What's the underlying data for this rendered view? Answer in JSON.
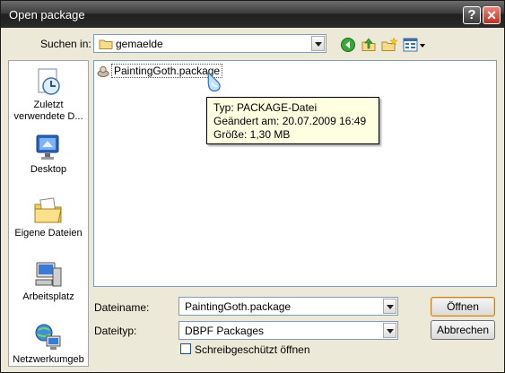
{
  "window": {
    "title": "Open package",
    "help_glyph": "?",
    "close_glyph": "✕"
  },
  "lookin": {
    "label": "Suchen in:",
    "value": "gemaelde"
  },
  "toolbar": {
    "icons": [
      "back-icon",
      "up-folder-icon",
      "new-folder-icon",
      "view-menu-icon"
    ]
  },
  "places": [
    {
      "label": "Zuletzt verwendete D...",
      "icon": "recent-documents-icon"
    },
    {
      "label": "Desktop",
      "icon": "desktop-icon"
    },
    {
      "label": "Eigene Dateien",
      "icon": "my-documents-icon"
    },
    {
      "label": "Arbeitsplatz",
      "icon": "my-computer-icon"
    },
    {
      "label": "Netzwerkumgeb",
      "icon": "network-places-icon"
    }
  ],
  "files": [
    {
      "name": "PaintingGoth.package",
      "icon": "package-file-icon",
      "selected": true
    }
  ],
  "tooltip": {
    "type": "Typ: PACKAGE-Datei",
    "modified": "Geändert am: 20.07.2009 16:49",
    "size": "Größe: 1,30 MB"
  },
  "filename": {
    "label": "Dateiname:",
    "value": "PaintingGoth.package"
  },
  "filetype": {
    "label": "Dateityp:",
    "value": "DBPF Packages"
  },
  "readonly": {
    "label": "Schreibgeschützt öffnen",
    "checked": false
  },
  "buttons": {
    "open": "Öffnen",
    "cancel": "Abbrechen"
  },
  "colors": {
    "titlebar": "#202020",
    "dialog_bg": "#ece9d8",
    "tooltip_bg": "#ffffe1",
    "combo_border": "#7f9db9"
  }
}
